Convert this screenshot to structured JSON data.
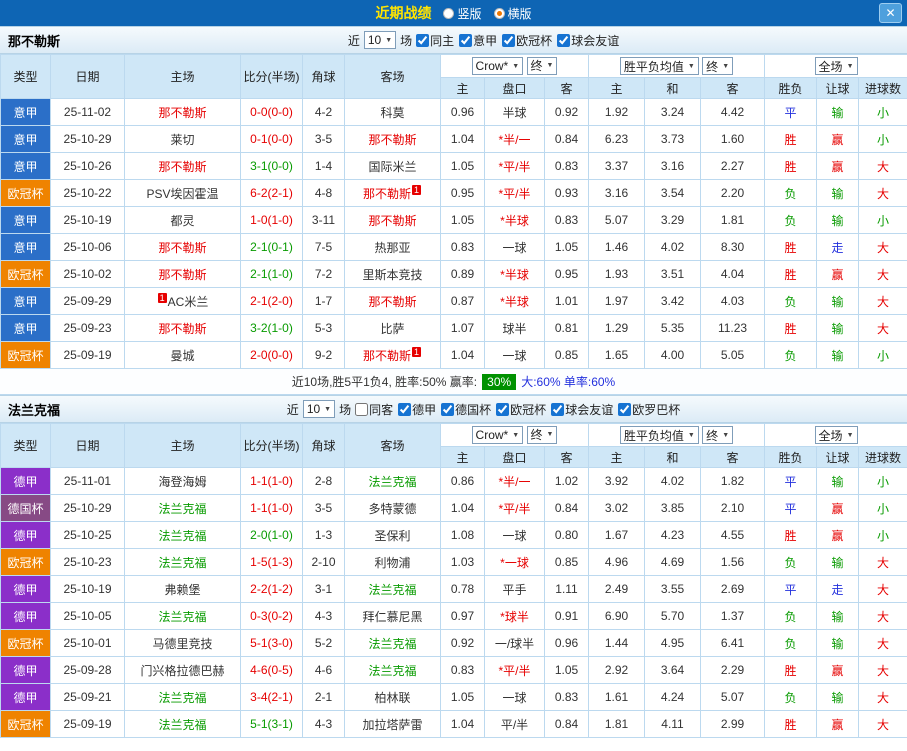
{
  "titlebar": {
    "title": "近期战绩",
    "layout_options": [
      {
        "label": "竖版",
        "selected": false
      },
      {
        "label": "横版",
        "selected": true
      }
    ],
    "close_label": "✕"
  },
  "colors": {
    "header_blue": "#0e65b4",
    "title_yellow": "#ffe400",
    "table_header_bg": "#cfe7f7",
    "border": "#bcd9ef",
    "win_red": "#e60000",
    "draw_blue": "#2330dd",
    "loss_green": "#089b00",
    "summary_green_bg": "#009100",
    "league_colors": {
      "意甲": "#2b6fc8",
      "欧冠杯": "#ef8300",
      "德甲": "#8b2fc9",
      "德国杯": "#874a85"
    }
  },
  "sections": [
    {
      "team": "那不勒斯",
      "focus_color": "#e60000",
      "near_label": "近",
      "count": "10",
      "games_label": "场",
      "filters": [
        {
          "label": "同主",
          "checked": true
        },
        {
          "label": "意甲",
          "checked": true
        },
        {
          "label": "欧冠杯",
          "checked": true
        },
        {
          "label": "球会友谊",
          "checked": true
        }
      ],
      "dropdowns": {
        "company": "Crow*",
        "final1": "终",
        "avg": "胜平负均值",
        "final2": "终",
        "scope": "全场"
      },
      "columns": [
        "类型",
        "日期",
        "主场",
        "比分(半场)",
        "角球",
        "客场",
        "主",
        "盘口",
        "客",
        "主",
        "和",
        "客",
        "胜负",
        "让球",
        "进球数"
      ],
      "rows": [
        {
          "league": "意甲",
          "date": "25-11-02",
          "home": "那不勒斯",
          "home_focus": true,
          "home_card": "",
          "home_card_before": false,
          "score": "0-0(0-0)",
          "score_color": "red",
          "corners": "4-2",
          "away": "科莫",
          "away_focus": false,
          "away_card": "",
          "ah_home": "0.96",
          "ah_line": "半球",
          "ah_away": "0.92",
          "eu_home": "1.92",
          "eu_draw": "3.24",
          "eu_away": "4.42",
          "result": "平",
          "cover": "输",
          "ou": "小"
        },
        {
          "league": "意甲",
          "date": "25-10-29",
          "home": "莱切",
          "home_focus": false,
          "home_card": "",
          "home_card_before": false,
          "score": "0-1(0-0)",
          "score_color": "red",
          "corners": "3-5",
          "away": "那不勒斯",
          "away_focus": true,
          "away_card": "",
          "ah_home": "1.04",
          "ah_line": "*半/一",
          "ah_away": "0.84",
          "eu_home": "6.23",
          "eu_draw": "3.73",
          "eu_away": "1.60",
          "result": "胜",
          "cover": "赢",
          "ou": "小"
        },
        {
          "league": "意甲",
          "date": "25-10-26",
          "home": "那不勒斯",
          "home_focus": true,
          "home_card": "",
          "home_card_before": false,
          "score": "3-1(0-0)",
          "score_color": "green",
          "corners": "1-4",
          "away": "国际米兰",
          "away_focus": false,
          "away_card": "",
          "ah_home": "1.05",
          "ah_line": "*平/半",
          "ah_away": "0.83",
          "eu_home": "3.37",
          "eu_draw": "3.16",
          "eu_away": "2.27",
          "result": "胜",
          "cover": "赢",
          "ou": "大"
        },
        {
          "league": "欧冠杯",
          "date": "25-10-22",
          "home": "PSV埃因霍温",
          "home_focus": false,
          "home_card": "",
          "home_card_before": false,
          "score": "6-2(2-1)",
          "score_color": "red",
          "corners": "4-8",
          "away": "那不勒斯",
          "away_focus": true,
          "away_card": "1",
          "ah_home": "0.95",
          "ah_line": "*平/半",
          "ah_away": "0.93",
          "eu_home": "3.16",
          "eu_draw": "3.54",
          "eu_away": "2.20",
          "result": "负",
          "cover": "输",
          "ou": "大"
        },
        {
          "league": "意甲",
          "date": "25-10-19",
          "home": "都灵",
          "home_focus": false,
          "home_card": "",
          "home_card_before": false,
          "score": "1-0(1-0)",
          "score_color": "red",
          "corners": "3-11",
          "away": "那不勒斯",
          "away_focus": true,
          "away_card": "",
          "ah_home": "1.05",
          "ah_line": "*半球",
          "ah_away": "0.83",
          "eu_home": "5.07",
          "eu_draw": "3.29",
          "eu_away": "1.81",
          "result": "负",
          "cover": "输",
          "ou": "小"
        },
        {
          "league": "意甲",
          "date": "25-10-06",
          "home": "那不勒斯",
          "home_focus": true,
          "home_card": "",
          "home_card_before": false,
          "score": "2-1(0-1)",
          "score_color": "green",
          "corners": "7-5",
          "away": "热那亚",
          "away_focus": false,
          "away_card": "",
          "ah_home": "0.83",
          "ah_line": "一球",
          "ah_away": "1.05",
          "eu_home": "1.46",
          "eu_draw": "4.02",
          "eu_away": "8.30",
          "result": "胜",
          "cover": "走",
          "ou": "大"
        },
        {
          "league": "欧冠杯",
          "date": "25-10-02",
          "home": "那不勒斯",
          "home_focus": true,
          "home_card": "",
          "home_card_before": false,
          "score": "2-1(1-0)",
          "score_color": "green",
          "corners": "7-2",
          "away": "里斯本竞技",
          "away_focus": false,
          "away_card": "",
          "ah_home": "0.89",
          "ah_line": "*半球",
          "ah_away": "0.95",
          "eu_home": "1.93",
          "eu_draw": "3.51",
          "eu_away": "4.04",
          "result": "胜",
          "cover": "赢",
          "ou": "大"
        },
        {
          "league": "意甲",
          "date": "25-09-29",
          "home": "AC米兰",
          "home_focus": false,
          "home_card": "1",
          "home_card_before": true,
          "score": "2-1(2-0)",
          "score_color": "red",
          "corners": "1-7",
          "away": "那不勒斯",
          "away_focus": true,
          "away_card": "",
          "ah_home": "0.87",
          "ah_line": "*半球",
          "ah_away": "1.01",
          "eu_home": "1.97",
          "eu_draw": "3.42",
          "eu_away": "4.03",
          "result": "负",
          "cover": "输",
          "ou": "大"
        },
        {
          "league": "意甲",
          "date": "25-09-23",
          "home": "那不勒斯",
          "home_focus": true,
          "home_card": "",
          "home_card_before": false,
          "score": "3-2(1-0)",
          "score_color": "green",
          "corners": "5-3",
          "away": "比萨",
          "away_focus": false,
          "away_card": "",
          "ah_home": "1.07",
          "ah_line": "球半",
          "ah_away": "0.81",
          "eu_home": "1.29",
          "eu_draw": "5.35",
          "eu_away": "11.23",
          "result": "胜",
          "cover": "输",
          "ou": "大"
        },
        {
          "league": "欧冠杯",
          "date": "25-09-19",
          "home": "曼城",
          "home_focus": false,
          "home_card": "",
          "home_card_before": false,
          "score": "2-0(0-0)",
          "score_color": "red",
          "corners": "9-2",
          "away": "那不勒斯",
          "away_focus": true,
          "away_card": "1",
          "ah_home": "1.04",
          "ah_line": "一球",
          "ah_away": "0.85",
          "eu_home": "1.65",
          "eu_draw": "4.00",
          "eu_away": "5.05",
          "result": "负",
          "cover": "输",
          "ou": "小"
        }
      ],
      "summary": {
        "text": "近10场,胜5平1负4, 胜率:50%  赢率:",
        "highlight": "30%",
        "tail": "大:60% 单率:60%"
      }
    },
    {
      "team": "法兰克福",
      "focus_color": "#089b00",
      "near_label": "近",
      "count": "10",
      "games_label": "场",
      "filters": [
        {
          "label": "同客",
          "checked": false
        },
        {
          "label": "德甲",
          "checked": true
        },
        {
          "label": "德国杯",
          "checked": true
        },
        {
          "label": "欧冠杯",
          "checked": true
        },
        {
          "label": "球会友谊",
          "checked": true
        },
        {
          "label": "欧罗巴杯",
          "checked": true
        }
      ],
      "dropdowns": {
        "company": "Crow*",
        "final1": "终",
        "avg": "胜平负均值",
        "final2": "终",
        "scope": "全场"
      },
      "columns": [
        "类型",
        "日期",
        "主场",
        "比分(半场)",
        "角球",
        "客场",
        "主",
        "盘口",
        "客",
        "主",
        "和",
        "客",
        "胜负",
        "让球",
        "进球数"
      ],
      "rows": [
        {
          "league": "德甲",
          "date": "25-11-01",
          "home": "海登海姆",
          "home_focus": false,
          "home_card": "",
          "home_card_before": false,
          "score": "1-1(1-0)",
          "score_color": "red",
          "corners": "2-8",
          "away": "法兰克福",
          "away_focus": true,
          "away_card": "",
          "ah_home": "0.86",
          "ah_line": "*半/一",
          "ah_away": "1.02",
          "eu_home": "3.92",
          "eu_draw": "4.02",
          "eu_away": "1.82",
          "result": "平",
          "cover": "输",
          "ou": "小"
        },
        {
          "league": "德国杯",
          "date": "25-10-29",
          "home": "法兰克福",
          "home_focus": true,
          "home_card": "",
          "home_card_before": false,
          "score": "1-1(1-0)",
          "score_color": "red",
          "corners": "3-5",
          "away": "多特蒙德",
          "away_focus": false,
          "away_card": "",
          "ah_home": "1.04",
          "ah_line": "*平/半",
          "ah_away": "0.84",
          "eu_home": "3.02",
          "eu_draw": "3.85",
          "eu_away": "2.10",
          "result": "平",
          "cover": "赢",
          "ou": "小"
        },
        {
          "league": "德甲",
          "date": "25-10-25",
          "home": "法兰克福",
          "home_focus": true,
          "home_card": "",
          "home_card_before": false,
          "score": "2-0(1-0)",
          "score_color": "green",
          "corners": "1-3",
          "away": "圣保利",
          "away_focus": false,
          "away_card": "",
          "ah_home": "1.08",
          "ah_line": "一球",
          "ah_away": "0.80",
          "eu_home": "1.67",
          "eu_draw": "4.23",
          "eu_away": "4.55",
          "result": "胜",
          "cover": "赢",
          "ou": "小"
        },
        {
          "league": "欧冠杯",
          "date": "25-10-23",
          "home": "法兰克福",
          "home_focus": true,
          "home_card": "",
          "home_card_before": false,
          "score": "1-5(1-3)",
          "score_color": "red",
          "corners": "2-10",
          "away": "利物浦",
          "away_focus": false,
          "away_card": "",
          "ah_home": "1.03",
          "ah_line": "*一球",
          "ah_away": "0.85",
          "eu_home": "4.96",
          "eu_draw": "4.69",
          "eu_away": "1.56",
          "result": "负",
          "cover": "输",
          "ou": "大"
        },
        {
          "league": "德甲",
          "date": "25-10-19",
          "home": "弗赖堡",
          "home_focus": false,
          "home_card": "",
          "home_card_before": false,
          "score": "2-2(1-2)",
          "score_color": "red",
          "corners": "3-1",
          "away": "法兰克福",
          "away_focus": true,
          "away_card": "",
          "ah_home": "0.78",
          "ah_line": "平手",
          "ah_away": "1.11",
          "eu_home": "2.49",
          "eu_draw": "3.55",
          "eu_away": "2.69",
          "result": "平",
          "cover": "走",
          "ou": "大"
        },
        {
          "league": "德甲",
          "date": "25-10-05",
          "home": "法兰克福",
          "home_focus": true,
          "home_card": "",
          "home_card_before": false,
          "score": "0-3(0-2)",
          "score_color": "red",
          "corners": "4-3",
          "away": "拜仁慕尼黑",
          "away_focus": false,
          "away_card": "",
          "ah_home": "0.97",
          "ah_line": "*球半",
          "ah_away": "0.91",
          "eu_home": "6.90",
          "eu_draw": "5.70",
          "eu_away": "1.37",
          "result": "负",
          "cover": "输",
          "ou": "大"
        },
        {
          "league": "欧冠杯",
          "date": "25-10-01",
          "home": "马德里竞技",
          "home_focus": false,
          "home_card": "",
          "home_card_before": false,
          "score": "5-1(3-0)",
          "score_color": "red",
          "corners": "5-2",
          "away": "法兰克福",
          "away_focus": true,
          "away_card": "",
          "ah_home": "0.92",
          "ah_line": "一/球半",
          "ah_away": "0.96",
          "eu_home": "1.44",
          "eu_draw": "4.95",
          "eu_away": "6.41",
          "result": "负",
          "cover": "输",
          "ou": "大"
        },
        {
          "league": "德甲",
          "date": "25-09-28",
          "home": "门兴格拉德巴赫",
          "home_focus": false,
          "home_card": "",
          "home_card_before": false,
          "score": "4-6(0-5)",
          "score_color": "red",
          "corners": "4-6",
          "away": "法兰克福",
          "away_focus": true,
          "away_card": "",
          "ah_home": "0.83",
          "ah_line": "*平/半",
          "ah_away": "1.05",
          "eu_home": "2.92",
          "eu_draw": "3.64",
          "eu_away": "2.29",
          "result": "胜",
          "cover": "赢",
          "ou": "大"
        },
        {
          "league": "德甲",
          "date": "25-09-21",
          "home": "法兰克福",
          "home_focus": true,
          "home_card": "",
          "home_card_before": false,
          "score": "3-4(2-1)",
          "score_color": "red",
          "corners": "2-1",
          "away": "柏林联",
          "away_focus": false,
          "away_card": "",
          "ah_home": "1.05",
          "ah_line": "一球",
          "ah_away": "0.83",
          "eu_home": "1.61",
          "eu_draw": "4.24",
          "eu_away": "5.07",
          "result": "负",
          "cover": "输",
          "ou": "大"
        },
        {
          "league": "欧冠杯",
          "date": "25-09-19",
          "home": "法兰克福",
          "home_focus": true,
          "home_card": "",
          "home_card_before": false,
          "score": "5-1(3-1)",
          "score_color": "green",
          "corners": "4-3",
          "away": "加拉塔萨雷",
          "away_focus": false,
          "away_card": "",
          "ah_home": "1.04",
          "ah_line": "平/半",
          "ah_away": "0.84",
          "eu_home": "1.81",
          "eu_draw": "4.11",
          "eu_away": "2.99",
          "result": "胜",
          "cover": "赢",
          "ou": "大"
        }
      ],
      "summary": null
    }
  ]
}
